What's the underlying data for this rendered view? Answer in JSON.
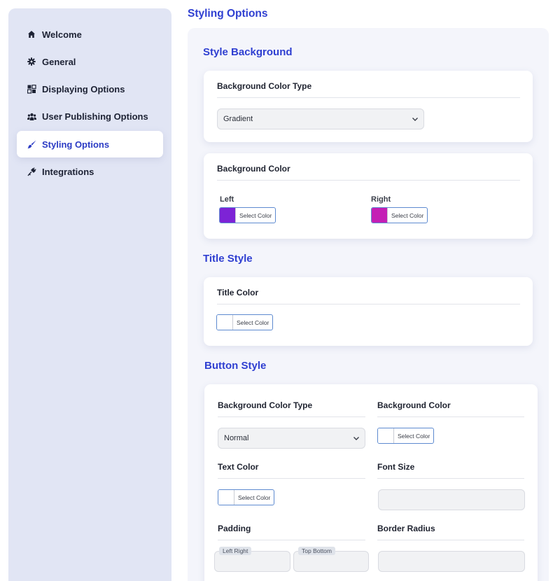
{
  "sidebar": {
    "items": [
      {
        "label": "Welcome",
        "icon": "home-icon"
      },
      {
        "label": "General",
        "icon": "gear-icon"
      },
      {
        "label": "Displaying Options",
        "icon": "display-icon"
      },
      {
        "label": "User Publishing Options",
        "icon": "users-icon"
      },
      {
        "label": "Styling Options",
        "icon": "brush-icon"
      },
      {
        "label": "Integrations",
        "icon": "plug-icon"
      }
    ],
    "active_index": 4
  },
  "page_title": "Styling Options",
  "style_background": {
    "title": "Style Background",
    "bg_type": {
      "label": "Background Color Type",
      "value": "Gradient"
    },
    "bg_color": {
      "label": "Background Color",
      "left": {
        "label": "Left",
        "button": "Select Color",
        "swatch": "#7d23d6"
      },
      "right": {
        "label": "Right",
        "button": "Select Color",
        "swatch": "#c41fb5"
      }
    }
  },
  "title_style": {
    "title": "Title Style",
    "title_color": {
      "label": "Title Color",
      "button": "Select Color",
      "swatch": "#ffffff"
    }
  },
  "button_style": {
    "title": "Button Style",
    "bg_type": {
      "label": "Background Color Type",
      "value": "Normal"
    },
    "bg_color": {
      "label": "Background Color",
      "button": "Select Color",
      "swatch": "#ffffff"
    },
    "text_color": {
      "label": "Text Color",
      "button": "Select Color",
      "swatch": "#ffffff"
    },
    "font_size": {
      "label": "Font Size",
      "value": ""
    },
    "padding": {
      "label": "Padding",
      "left_right": "Left Right",
      "top_bottom": "Top Bottom"
    },
    "border_radius": {
      "label": "Border Radius",
      "value": ""
    }
  },
  "colors": {
    "accent": "#2f3fd1",
    "sidebar_bg": "#e1e5f4",
    "panel_bg": "#f4f5fb"
  }
}
